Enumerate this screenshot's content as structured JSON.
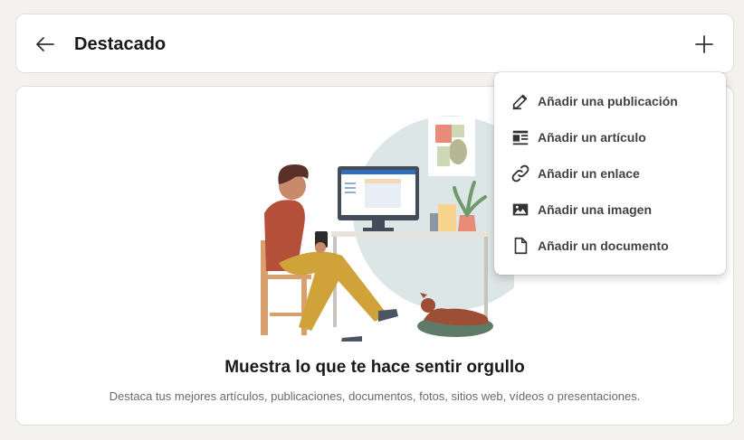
{
  "header": {
    "title": "Destacado",
    "back_icon": "arrow-left-icon",
    "add_icon": "plus-icon"
  },
  "empty_state": {
    "title": "Muestra lo que te hace sentir orgullo",
    "description": "Destaca tus mejores artículos, publicaciones, documentos, fotos, sitios web, vídeos o presentaciones."
  },
  "menu": {
    "items": [
      {
        "label": "Añadir una publicación",
        "icon": "pencil-icon"
      },
      {
        "label": "Añadir un artículo",
        "icon": "article-icon"
      },
      {
        "label": "Añadir un enlace",
        "icon": "link-icon"
      },
      {
        "label": "Añadir una imagen",
        "icon": "image-icon"
      },
      {
        "label": "Añadir un documento",
        "icon": "document-icon"
      }
    ]
  }
}
